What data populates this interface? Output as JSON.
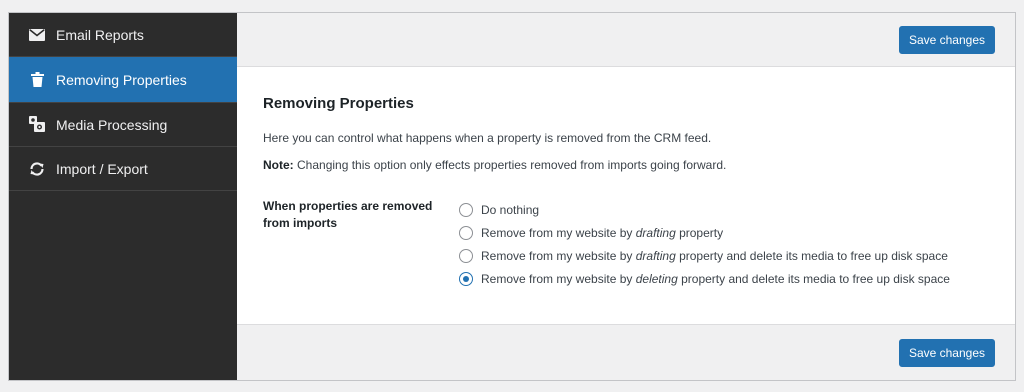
{
  "sidebar": {
    "items": [
      {
        "label": "Email Reports",
        "icon": "envelope-icon",
        "active": false
      },
      {
        "label": "Removing Properties",
        "icon": "trash-icon",
        "active": true
      },
      {
        "label": "Media Processing",
        "icon": "media-icon",
        "active": false
      },
      {
        "label": "Import / Export",
        "icon": "sync-icon",
        "active": false
      }
    ]
  },
  "toolbar": {
    "save_label": "Save changes"
  },
  "section": {
    "title": "Removing Properties",
    "description": "Here you can control what happens when a property is removed from the CRM feed.",
    "note_label": "Note:",
    "note_text": " Changing this option only effects properties removed from imports going forward."
  },
  "setting": {
    "label": "When properties are removed from imports",
    "selected_index": 3,
    "options": [
      {
        "before": "Do nothing",
        "emph": "",
        "after": ""
      },
      {
        "before": "Remove from my website by ",
        "emph": "drafting",
        "after": " property"
      },
      {
        "before": "Remove from my website by ",
        "emph": "drafting",
        "after": " property and delete its media to free up disk space"
      },
      {
        "before": "Remove from my website by ",
        "emph": "deleting",
        "after": " property and delete its media to free up disk space"
      }
    ]
  },
  "colors": {
    "accent": "#2271b1",
    "sidebar_bg": "#2c2c2c",
    "page_bg": "#f0f0f1"
  }
}
